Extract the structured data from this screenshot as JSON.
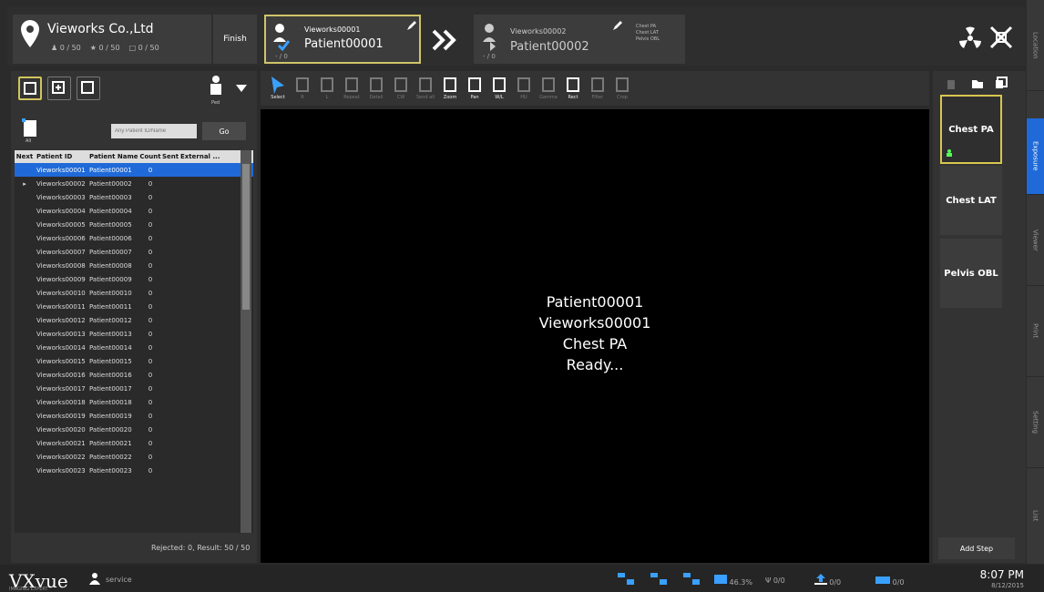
{
  "hospital": {
    "name": "Vieworks Co.,Ltd",
    "stat1": "0 / 50",
    "stat2": "0 / 50",
    "stat3": "0 / 50",
    "finish": "Finish"
  },
  "patient1": {
    "id": "Vieworks00001",
    "name": "Patient00001",
    "count": "- / 0"
  },
  "patient2": {
    "id": "Vieworks00002",
    "name": "Patient00002",
    "count": "- / 0",
    "steps": [
      "Chest PA",
      "Chest LAT",
      "Pelvis OBL"
    ]
  },
  "sidebar": [
    "Location",
    "Exposure",
    "Viewer",
    "Print",
    "Setting",
    "List"
  ],
  "left": {
    "search_placeholder": "Any Patient ID/Name",
    "go": "Go",
    "all": "All",
    "ped": "Ped",
    "footer": "Rejected: 0, Result: 50 / 50"
  },
  "columns": [
    "Next",
    "Patient ID",
    "Patient Name",
    "Count",
    "Sent",
    "External ..."
  ],
  "rows": [
    [
      "Vieworks00001",
      "Patient00001",
      "0"
    ],
    [
      "Vieworks00002",
      "Patient00002",
      "0"
    ],
    [
      "Vieworks00003",
      "Patient00003",
      "0"
    ],
    [
      "Vieworks00004",
      "Patient00004",
      "0"
    ],
    [
      "Vieworks00005",
      "Patient00005",
      "0"
    ],
    [
      "Vieworks00006",
      "Patient00006",
      "0"
    ],
    [
      "Vieworks00007",
      "Patient00007",
      "0"
    ],
    [
      "Vieworks00008",
      "Patient00008",
      "0"
    ],
    [
      "Vieworks00009",
      "Patient00009",
      "0"
    ],
    [
      "Vieworks00010",
      "Patient00010",
      "0"
    ],
    [
      "Vieworks00011",
      "Patient00011",
      "0"
    ],
    [
      "Vieworks00012",
      "Patient00012",
      "0"
    ],
    [
      "Vieworks00013",
      "Patient00013",
      "0"
    ],
    [
      "Vieworks00014",
      "Patient00014",
      "0"
    ],
    [
      "Vieworks00015",
      "Patient00015",
      "0"
    ],
    [
      "Vieworks00016",
      "Patient00016",
      "0"
    ],
    [
      "Vieworks00017",
      "Patient00017",
      "0"
    ],
    [
      "Vieworks00018",
      "Patient00018",
      "0"
    ],
    [
      "Vieworks00019",
      "Patient00019",
      "0"
    ],
    [
      "Vieworks00020",
      "Patient00020",
      "0"
    ],
    [
      "Vieworks00021",
      "Patient00021",
      "0"
    ],
    [
      "Vieworks00022",
      "Patient00022",
      "0"
    ],
    [
      "Vieworks00023",
      "Patient00023",
      "0"
    ]
  ],
  "tools": [
    "Select",
    "R",
    "L",
    "Repeat",
    "Detail",
    "CW",
    "Send all",
    "Zoom",
    "Pan",
    "W/L",
    "HU",
    "Gamma",
    "Rect",
    "Filter",
    "Crop"
  ],
  "viewer": {
    "line1": "Patient00001",
    "line2": "Vieworks00001",
    "line3": "Chest PA",
    "line4": "Ready..."
  },
  "steps": {
    "s1": "Chest PA",
    "s2": "Chest LAT",
    "s3": "Pelvis OBL",
    "add": "Add Step"
  },
  "status": {
    "brand": "VXvue",
    "tagline": "IMAGING EXPERT",
    "user": "service",
    "d1": "1",
    "d2": "2",
    "d3": "3",
    "disk": "46.3%",
    "usb": "0/0",
    "upload": "0/0",
    "print": "0/0",
    "time": "8:07 PM",
    "date": "8/12/2015"
  },
  "colors": {
    "accent": "#1f6ad8",
    "highlight": "#d8c64f"
  }
}
